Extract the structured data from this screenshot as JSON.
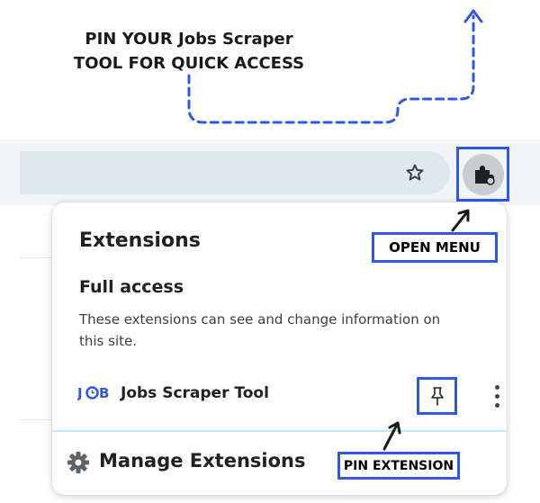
{
  "headline": {
    "line1": "PIN YOUR Jobs Scraper",
    "line2": "TOOL FOR QUICK ACCESS"
  },
  "toolbar": {
    "bookmark_icon": "star-icon",
    "extensions_icon": "puzzle-piece-icon"
  },
  "popup": {
    "title": "Extensions",
    "section_title": "Full access",
    "section_desc": "These extensions can see and change information on this site.",
    "extension": {
      "logo_text": "JOB",
      "name": "Jobs Scraper Tool",
      "pin_icon": "pin-icon",
      "more_icon": "more-vert-icon"
    },
    "manage_label": "Manage Extensions"
  },
  "callouts": {
    "open_menu": "OPEN MENU",
    "pin_extension": "PIN EXTENSION"
  },
  "colors": {
    "accent": "#2f57e8",
    "omnibox": "#dfe8ec",
    "divider": "#bfe9f4"
  }
}
